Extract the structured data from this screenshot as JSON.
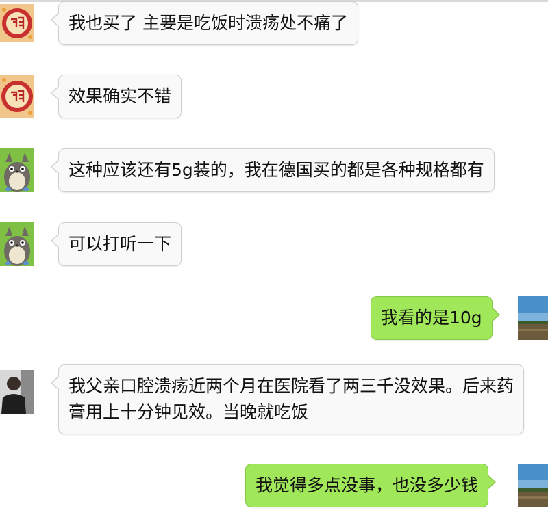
{
  "chat": {
    "messages": [
      {
        "sender": "fu-avatar",
        "side": "left",
        "text": "我也买了 主要是吃饭时溃疡处不痛了"
      },
      {
        "sender": "fu-avatar",
        "side": "left",
        "text": "效果确实不错"
      },
      {
        "sender": "totoro-avatar",
        "side": "left",
        "text": "这种应该还有5g装的，我在德国买的都是各种规格都有"
      },
      {
        "sender": "totoro-avatar",
        "side": "left",
        "text": "可以打听一下"
      },
      {
        "sender": "landscape-avatar",
        "side": "right",
        "text": "我看的是10g"
      },
      {
        "sender": "person-avatar",
        "side": "left",
        "lines": [
          "我父亲口腔溃疡近两个月在医院看了两三千没效果。后来药",
          "膏用上十分钟见效。当晚就吃饭"
        ]
      },
      {
        "sender": "landscape-avatar",
        "side": "right",
        "text": "我觉得多点没事，也没多少钱"
      }
    ]
  },
  "avatars": {
    "fu": {
      "icon": "fu-new-year-avatar",
      "color": "#b8262a"
    },
    "totoro": {
      "icon": "totoro-avatar",
      "color": "#7fc045"
    },
    "person": {
      "icon": "person-photo-avatar",
      "color": "#2a2a2a"
    },
    "landscape": {
      "icon": "landscape-photo-avatar",
      "color": "#4a90c8"
    }
  },
  "colors": {
    "incoming_bubble": "#f9f9f9",
    "outgoing_bubble": "#a0e75a"
  }
}
